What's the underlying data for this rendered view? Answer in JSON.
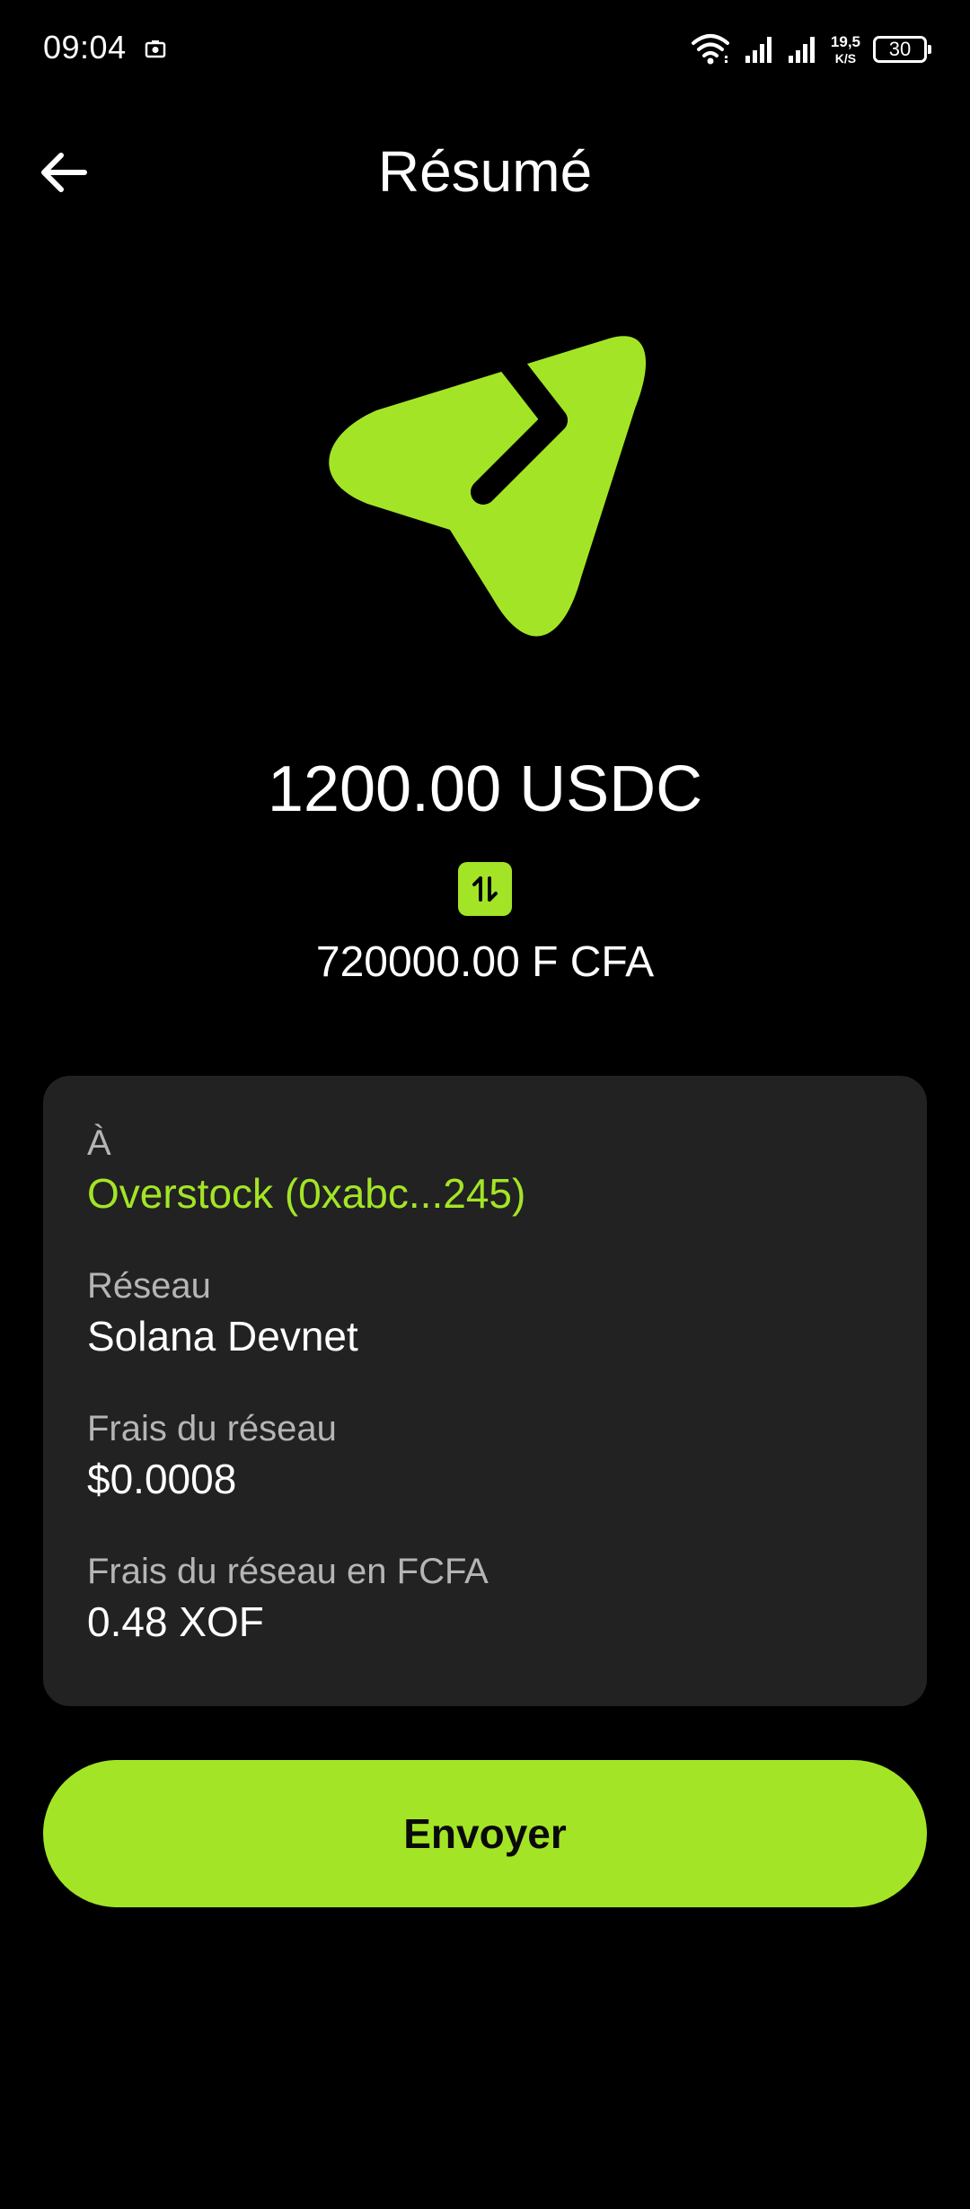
{
  "status_bar": {
    "time": "09:04",
    "net_speed_value": "19,5",
    "net_speed_unit": "K/S",
    "battery_level": "30"
  },
  "header": {
    "title": "Résumé"
  },
  "transaction": {
    "amount": "1200.00 USDC",
    "converted_amount": "720000.00 F CFA"
  },
  "details": [
    {
      "label": "À",
      "value": "Overstock (0xabc...245)",
      "accent": true
    },
    {
      "label": "Réseau",
      "value": "Solana Devnet",
      "accent": false
    },
    {
      "label": "Frais du réseau",
      "value": "$0.0008",
      "accent": false
    },
    {
      "label": "Frais du réseau en FCFA",
      "value": "0.48 XOF",
      "accent": false
    }
  ],
  "actions": {
    "send_label": "Envoyer"
  },
  "icons": {
    "back": "arrow-left-icon",
    "send": "send-arrow-icon",
    "swap": "swap-vertical-icon",
    "wifi": "wifi-icon",
    "signal": "cellular-signal-icon",
    "battery": "battery-icon",
    "screenshot": "camera-icon"
  },
  "colors": {
    "background": "#000000",
    "accent": "#a3e526",
    "card": "#222222",
    "label": "#b5b5b5",
    "text": "#ffffff"
  }
}
